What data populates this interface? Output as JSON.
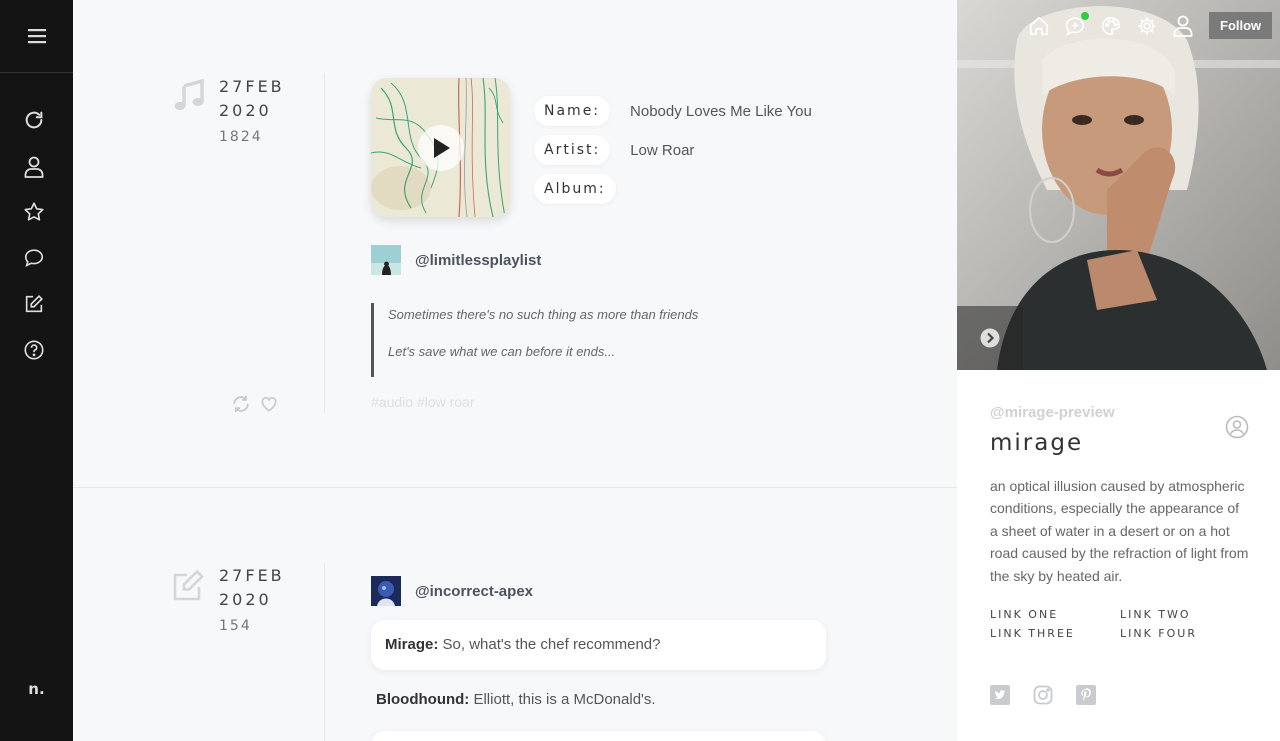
{
  "sidebar": {
    "brand": "n.",
    "items": [
      {
        "name": "refresh-icon"
      },
      {
        "name": "user-icon"
      },
      {
        "name": "star-icon"
      },
      {
        "name": "chat-icon"
      },
      {
        "name": "edit-icon"
      },
      {
        "name": "help-icon"
      }
    ]
  },
  "posts": [
    {
      "type_icon": "music-icon",
      "date_day": "27FEB",
      "date_year": "2020",
      "notes": "1824",
      "track": {
        "name_label": "Name:",
        "name_value": "Nobody Loves Me Like You",
        "artist_label": "Artist:",
        "artist_value": "Low Roar",
        "album_label": "Album:",
        "album_value": ""
      },
      "username": "@limitlessplaylist",
      "quote": [
        "Sometimes there's no such thing as more than friends",
        "Let's save what we can before it ends..."
      ],
      "tags": "#audio #low roar"
    },
    {
      "type_icon": "edit-icon",
      "date_day": "27FEB",
      "date_year": "2020",
      "notes": "154",
      "username": "@incorrect-apex",
      "chat": [
        {
          "speaker": "Mirage:",
          "text": "So, what's the chef recommend?"
        },
        {
          "speaker": "Bloodhound:",
          "text": "Elliott, this is a McDonald's."
        }
      ]
    }
  ],
  "topbar": {
    "follow_label": "Follow"
  },
  "profile": {
    "handle": "@mirage-preview",
    "title": "mirage",
    "description": "an optical illusion caused by atmospheric conditions, especially the appearance of a sheet of water in a desert or on a hot road caused by the refraction of light from the sky by heated air.",
    "links": [
      "LINK ONE",
      "LINK TWO",
      "LINK THREE",
      "LINK FOUR"
    ],
    "socials": [
      "twitter-icon",
      "instagram-icon",
      "pinterest-icon"
    ]
  },
  "colors": {
    "sidebar_bg": "#141414",
    "page_bg": "#f7f8fa",
    "notification_dot": "#2ecc40",
    "follow_bg": "#7a7a7a"
  }
}
